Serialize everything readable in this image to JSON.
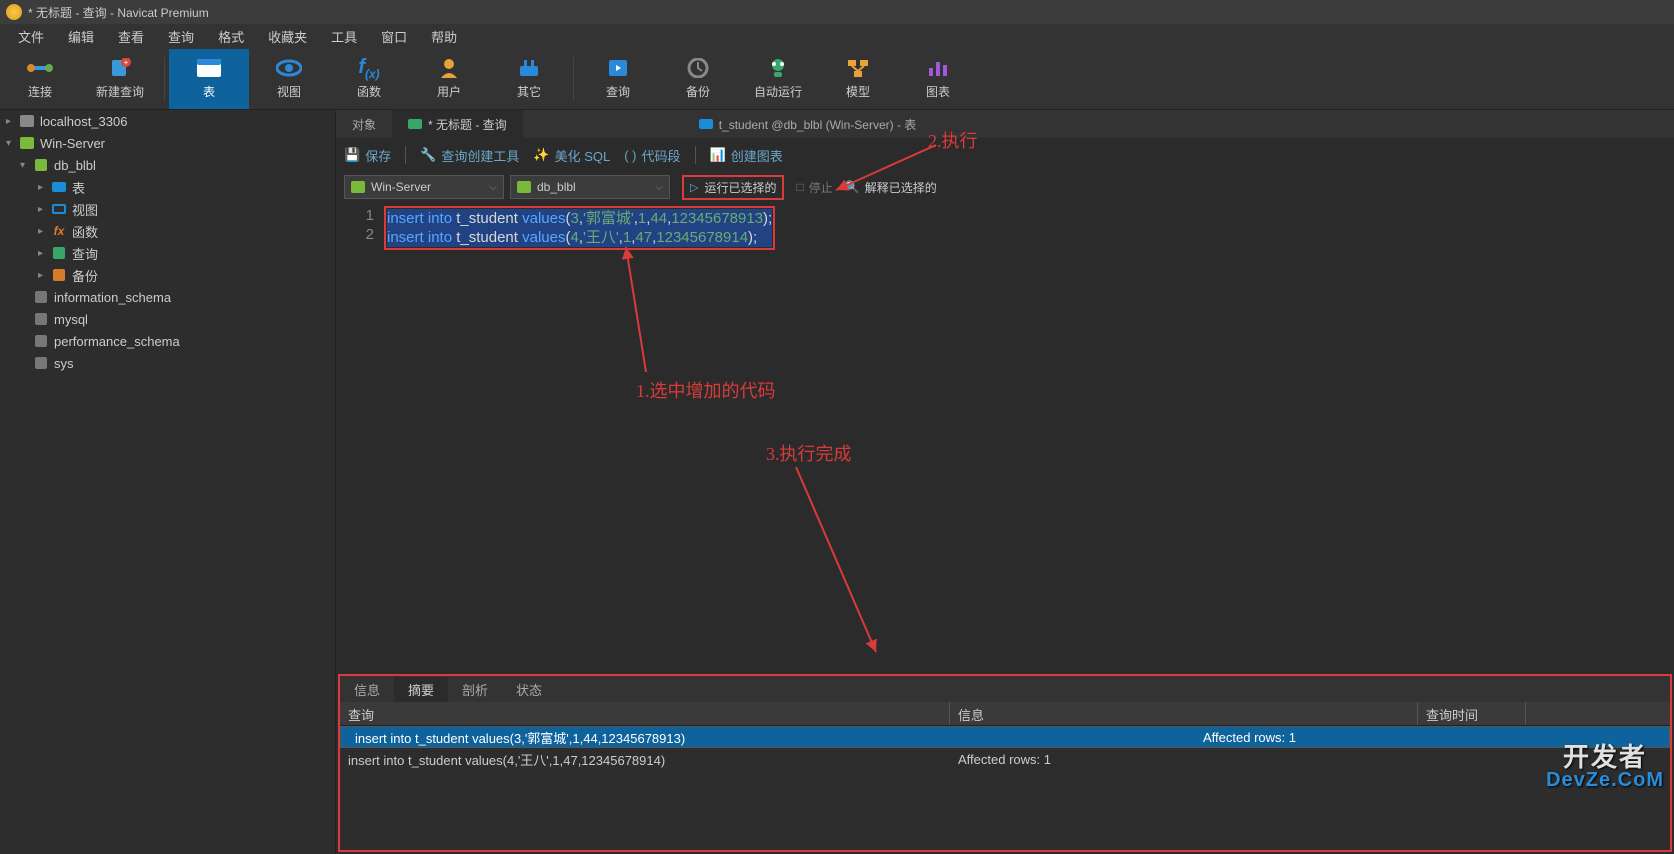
{
  "window_title": "* 无标题 - 查询 - Navicat Premium",
  "menu": {
    "file": "文件",
    "edit": "编辑",
    "view": "查看",
    "query": "查询",
    "format": "格式",
    "favorites": "收藏夹",
    "tools": "工具",
    "window": "窗口",
    "help": "帮助"
  },
  "toolbar": {
    "connect": "连接",
    "new_query": "新建查询",
    "table": "表",
    "view": "视图",
    "function": "函数",
    "user": "用户",
    "other": "其它",
    "query": "查询",
    "backup": "备份",
    "autorun": "自动运行",
    "model": "模型",
    "chart": "图表"
  },
  "sidebar": {
    "conn1": "localhost_3306",
    "conn2": "Win-Server",
    "db1": "db_blbl",
    "db1_children": {
      "table": "表",
      "view": "视图",
      "function": "函数",
      "query": "查询",
      "backup": "备份"
    },
    "db2": "information_schema",
    "db3": "mysql",
    "db4": "performance_schema",
    "db5": "sys"
  },
  "tabs": {
    "object": "对象",
    "untitled": "* 无标题 - 查询",
    "tstudent": "t_student @db_blbl (Win-Server) - 表"
  },
  "actions": {
    "save": "保存",
    "query_builder": "查询创建工具",
    "beautify_sql": "美化 SQL",
    "code_snippet": "代码段",
    "create_chart": "创建图表"
  },
  "selectors": {
    "server": "Win-Server",
    "database": "db_blbl"
  },
  "run": {
    "run_selected": "运行已选择的",
    "stop": "停止",
    "explain_selected": "解释已选择的"
  },
  "editor": {
    "lines": [
      "1",
      "2"
    ],
    "code_tokens": [
      [
        {
          "t": "insert",
          "c": "kw"
        },
        {
          "t": " ",
          "c": "p"
        },
        {
          "t": "into",
          "c": "kw"
        },
        {
          "t": " ",
          "c": "p"
        },
        {
          "t": "t_student",
          "c": "ident"
        },
        {
          "t": " ",
          "c": "p"
        },
        {
          "t": "values",
          "c": "kw"
        },
        {
          "t": "(",
          "c": "punct"
        },
        {
          "t": "3",
          "c": "num"
        },
        {
          "t": ",",
          "c": "punct"
        },
        {
          "t": "'郭富城'",
          "c": "str"
        },
        {
          "t": ",",
          "c": "punct"
        },
        {
          "t": "1",
          "c": "num"
        },
        {
          "t": ",",
          "c": "punct"
        },
        {
          "t": "44",
          "c": "num"
        },
        {
          "t": ",",
          "c": "punct"
        },
        {
          "t": "12345678913",
          "c": "num"
        },
        {
          "t": ");",
          "c": "punct"
        }
      ],
      [
        {
          "t": "insert",
          "c": "kw"
        },
        {
          "t": " ",
          "c": "p"
        },
        {
          "t": "into",
          "c": "kw"
        },
        {
          "t": " ",
          "c": "p"
        },
        {
          "t": "t_student",
          "c": "ident"
        },
        {
          "t": " ",
          "c": "p"
        },
        {
          "t": "values",
          "c": "kw"
        },
        {
          "t": "(",
          "c": "punct"
        },
        {
          "t": "4",
          "c": "num"
        },
        {
          "t": ",",
          "c": "punct"
        },
        {
          "t": "'王八'",
          "c": "str"
        },
        {
          "t": ",",
          "c": "punct"
        },
        {
          "t": "1",
          "c": "num"
        },
        {
          "t": ",",
          "c": "punct"
        },
        {
          "t": "47",
          "c": "num"
        },
        {
          "t": ",",
          "c": "punct"
        },
        {
          "t": "12345678914",
          "c": "num"
        },
        {
          "t": ");",
          "c": "punct"
        }
      ]
    ]
  },
  "annotations": {
    "a1": "1.选中增加的代码",
    "a2": "2.执行",
    "a3": "3.执行完成"
  },
  "result": {
    "tabs": {
      "info": "信息",
      "summary": "摘要",
      "profile": "剖析",
      "status": "状态"
    },
    "headers": {
      "query": "查询",
      "info": "信息",
      "time": "查询时间"
    },
    "rows": [
      {
        "query": "insert into t_student values(3,'郭富城',1,44,12345678913)",
        "info": "Affected rows: 1"
      },
      {
        "query": "insert into t_student values(4,'王八',1,47,12345678914)",
        "info": "Affected rows: 1"
      }
    ]
  },
  "watermark": {
    "line1": "开发者",
    "line2": "DevZe.CoM"
  }
}
